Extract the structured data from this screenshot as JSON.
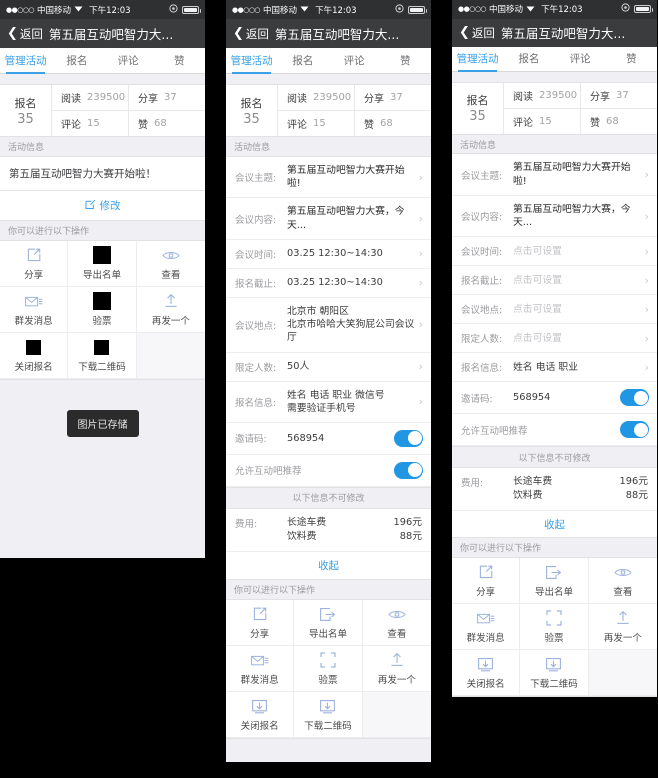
{
  "status_bar": {
    "signal_dots": "●●○○○",
    "carrier": "中国移动",
    "wifi_icon": "wifi-icon",
    "time": "下午12:03",
    "battery_icon": "battery-icon"
  },
  "nav": {
    "back_icon": "chevron-left-icon",
    "back_label": "返回",
    "title": "第五届互动吧智力大..."
  },
  "tabs": [
    {
      "label": "管理活动",
      "active": true
    },
    {
      "label": "报名",
      "active": false
    },
    {
      "label": "评论",
      "active": false
    },
    {
      "label": "赞",
      "active": false
    }
  ],
  "stats": {
    "main_label": "报名",
    "main_value": "35",
    "cells": [
      {
        "key": "阅读",
        "value": "239500"
      },
      {
        "key": "分享",
        "value": "37"
      },
      {
        "key": "评论",
        "value": "15"
      },
      {
        "key": "赞",
        "value": "68"
      }
    ]
  },
  "section_activity_info": "活动信息",
  "section_actions": "你可以进行以下操作",
  "panel1": {
    "activity_text": "第五届互动吧智力大赛开始啦！",
    "edit_icon": "edit-icon",
    "edit_label": "修改",
    "toast": "图片已存储"
  },
  "panel2": {
    "rows": [
      {
        "label": "会议主题:",
        "value": "第五届互动吧智力大赛开始啦!",
        "muted": false,
        "chevron": "chevron-right-icon"
      },
      {
        "label": "会议内容:",
        "value": "第五届互动吧智力大赛，今天...",
        "muted": false,
        "chevron": "chevron-right-icon"
      },
      {
        "label": "会议时间:",
        "value": "03.25  12:30~14:30",
        "muted": false,
        "chevron": "chevron-right-icon"
      },
      {
        "label": "报名截止:",
        "value": "03.25  12:30~14:30",
        "muted": false,
        "chevron": "chevron-right-icon"
      },
      {
        "label": "会议地点:",
        "value": "北京市 朝阳区\n北京市哈哈大笑狗屁公司会议厅",
        "muted": false,
        "chevron": "chevron-right-icon"
      },
      {
        "label": "限定人数:",
        "value": "50人",
        "muted": false,
        "chevron": "chevron-right-icon"
      },
      {
        "label": "报名信息:",
        "value": "姓名  电话  职业  微信号\n需要验证手机号",
        "muted": false,
        "chevron": "chevron-right-icon"
      }
    ],
    "invite_code": {
      "label": "邀请码:",
      "value": "568954",
      "toggle_on": true
    },
    "recommend": {
      "label": "允许互动吧推荐",
      "toggle_on": true
    },
    "notice": "以下信息不可修改",
    "fee": {
      "label": "费用:",
      "items": [
        {
          "name": "长途车费",
          "amount": "196元"
        },
        {
          "name": "饮料费",
          "amount": "88元"
        }
      ]
    },
    "collapse_label": "收起"
  },
  "panel3": {
    "rows": [
      {
        "label": "会议主题:",
        "value": "第五届互动吧智力大赛开始啦!",
        "muted": false,
        "chevron": "chevron-right-icon"
      },
      {
        "label": "会议内容:",
        "value": "第五届互动吧智力大赛，今天...",
        "muted": false,
        "chevron": "chevron-right-icon"
      },
      {
        "label": "会议时间:",
        "value": "点击可设置",
        "muted": true,
        "chevron": "chevron-right-icon"
      },
      {
        "label": "报名截止:",
        "value": "点击可设置",
        "muted": true,
        "chevron": "chevron-right-icon"
      },
      {
        "label": "会议地点:",
        "value": "点击可设置",
        "muted": true,
        "chevron": "chevron-right-icon"
      },
      {
        "label": "限定人数:",
        "value": "点击可设置",
        "muted": true,
        "chevron": "chevron-right-icon"
      },
      {
        "label": "报名信息:",
        "value": "姓名  电话  职业",
        "muted": false,
        "chevron": "chevron-right-icon"
      }
    ],
    "invite_code": {
      "label": "邀请码:",
      "value": "568954",
      "toggle_on": true
    },
    "recommend": {
      "label": "允许互动吧推荐",
      "toggle_on": true
    },
    "notice": "以下信息不可修改",
    "fee": {
      "label": "费用:",
      "items": [
        {
          "name": "长途车费",
          "amount": "196元"
        },
        {
          "name": "饮料费",
          "amount": "88元"
        }
      ]
    },
    "collapse_label": "收起"
  },
  "actions": [
    {
      "label": "分享",
      "icon": "share-icon",
      "placeholder": false
    },
    {
      "label": "导出名单",
      "icon": "export-icon",
      "placeholder": true
    },
    {
      "label": "查看",
      "icon": "eye-icon",
      "placeholder": false
    },
    {
      "label": "群发消息",
      "icon": "mail-icon",
      "placeholder": false
    },
    {
      "label": "验票",
      "icon": "scan-icon",
      "placeholder": true
    },
    {
      "label": "再发一个",
      "icon": "upload-icon",
      "placeholder": false
    },
    {
      "label": "关闭报名",
      "icon": "download-box-icon",
      "placeholder": true
    },
    {
      "label": "下载二维码",
      "icon": "download-qr-icon",
      "placeholder": true
    }
  ],
  "colors": {
    "accent": "#3aa0e8",
    "switch_on": "#2196e3",
    "nav_bg": "#3a3c3e",
    "status_bg": "#2f3031",
    "page_bg": "#efeff4",
    "icon_blue": "#8fa8d8"
  }
}
